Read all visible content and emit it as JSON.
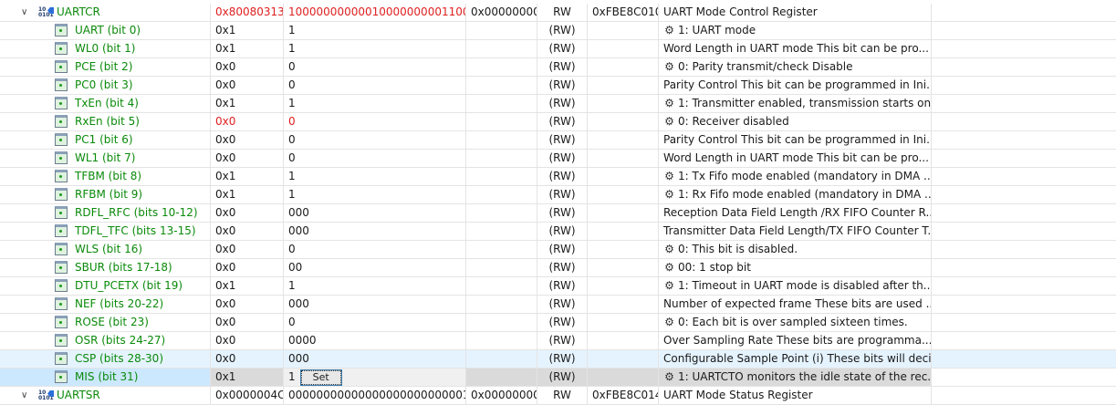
{
  "registers": [
    {
      "name": "UARTCR",
      "value": "0x80080313",
      "binary": "10000000000010000000001100...",
      "reset": "0x00000000",
      "access": "RW",
      "address": "0xFBE8C010",
      "description": "UART Mode Control Register",
      "changed": true
    },
    {
      "name": "UARTSR",
      "value": "0x0000004C",
      "binary": "00000000000000000000000001...",
      "reset": "0x00000000",
      "access": "RW",
      "address": "0xFBE8C014",
      "description": "UART Mode Status Register",
      "changed": false
    }
  ],
  "fields": [
    {
      "name": "UART (bit 0)",
      "value": "0x1",
      "binary": "1",
      "access": "(RW)",
      "description": "1: UART mode",
      "enum": true
    },
    {
      "name": "WL0 (bit 1)",
      "value": "0x1",
      "binary": "1",
      "access": "(RW)",
      "description": "Word Length in UART mode This bit can be pro...",
      "enum": false
    },
    {
      "name": "PCE (bit 2)",
      "value": "0x0",
      "binary": "0",
      "access": "(RW)",
      "description": "0: Parity transmit/check Disable",
      "enum": true
    },
    {
      "name": "PC0 (bit 3)",
      "value": "0x0",
      "binary": "0",
      "access": "(RW)",
      "description": "Parity Control This bit can be programmed in Ini...",
      "enum": false
    },
    {
      "name": "TxEn (bit 4)",
      "value": "0x1",
      "binary": "1",
      "access": "(RW)",
      "description": "1: Transmitter enabled, transmission starts on...",
      "enum": true
    },
    {
      "name": "RxEn (bit 5)",
      "value": "0x0",
      "binary": "0",
      "access": "(RW)",
      "description": "0: Receiver disabled",
      "enum": true,
      "changed": true
    },
    {
      "name": "PC1 (bit 6)",
      "value": "0x0",
      "binary": "0",
      "access": "(RW)",
      "description": "Parity Control This bit can be programmed in Ini...",
      "enum": false
    },
    {
      "name": "WL1 (bit 7)",
      "value": "0x0",
      "binary": "0",
      "access": "(RW)",
      "description": "Word Length in UART mode This bit can be pro...",
      "enum": false
    },
    {
      "name": "TFBM (bit 8)",
      "value": "0x1",
      "binary": "1",
      "access": "(RW)",
      "description": "1: Tx Fifo mode enabled (mandatory in DMA ...",
      "enum": true
    },
    {
      "name": "RFBM (bit 9)",
      "value": "0x1",
      "binary": "1",
      "access": "(RW)",
      "description": "1: Rx Fifo mode enabled (mandatory in DMA ...",
      "enum": true
    },
    {
      "name": "RDFL_RFC (bits 10-12)",
      "value": "0x0",
      "binary": "000",
      "access": "(RW)",
      "description": "Reception Data Field Length /RX FIFO Counter R...",
      "enum": false
    },
    {
      "name": "TDFL_TFC (bits 13-15)",
      "value": "0x0",
      "binary": "000",
      "access": "(RW)",
      "description": "Transmitter Data Field Length/TX FIFO Counter T...",
      "enum": false
    },
    {
      "name": "WLS (bit 16)",
      "value": "0x0",
      "binary": "0",
      "access": "(RW)",
      "description": "0: This bit is disabled.",
      "enum": true
    },
    {
      "name": "SBUR (bits 17-18)",
      "value": "0x0",
      "binary": "00",
      "access": "(RW)",
      "description": "00: 1 stop bit",
      "enum": true
    },
    {
      "name": "DTU_PCETX (bit 19)",
      "value": "0x1",
      "binary": "1",
      "access": "(RW)",
      "description": "1: Timeout in UART mode is disabled after th...",
      "enum": true
    },
    {
      "name": "NEF (bits 20-22)",
      "value": "0x0",
      "binary": "000",
      "access": "(RW)",
      "description": "Number of expected frame These bits are used ...",
      "enum": false
    },
    {
      "name": "ROSE (bit 23)",
      "value": "0x0",
      "binary": "0",
      "access": "(RW)",
      "description": "0: Each bit is over sampled sixteen times.",
      "enum": true
    },
    {
      "name": "OSR (bits 24-27)",
      "value": "0x0",
      "binary": "0000",
      "access": "(RW)",
      "description": "Over Sampling Rate These bits are programma...",
      "enum": false
    },
    {
      "name": "CSP (bits 28-30)",
      "value": "0x0",
      "binary": "000",
      "access": "(RW)",
      "description": "Configurable Sample Point (i) These bits will deci...",
      "enum": false,
      "hover": true
    },
    {
      "name": "MIS (bit 31)",
      "value": "0x1",
      "binary": "1",
      "access": "(RW)",
      "description": "1: UARTCTO monitors the idle state of the rec...",
      "enum": true,
      "selected": true
    }
  ],
  "set_button_label": "Set",
  "register_icon_text": "10\n0101"
}
